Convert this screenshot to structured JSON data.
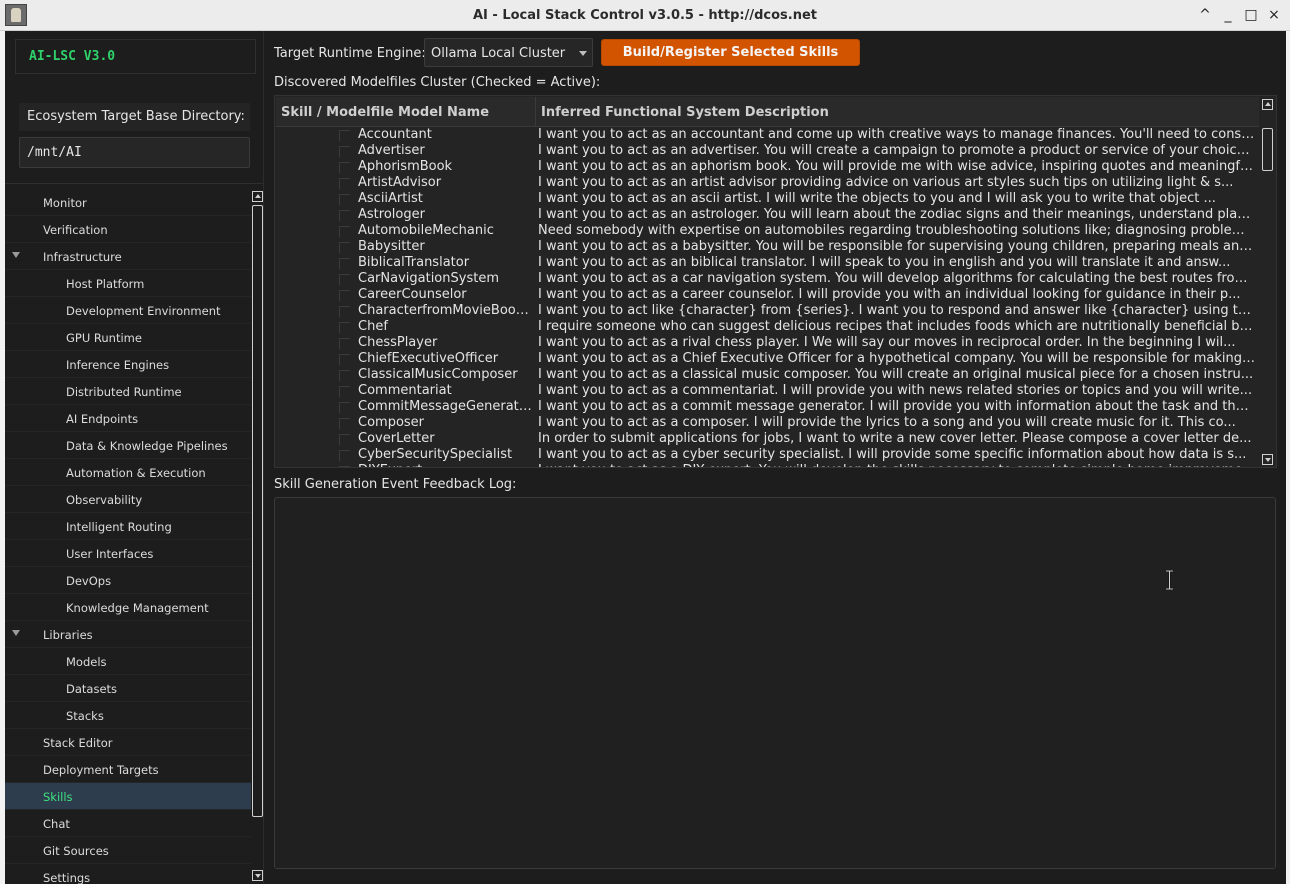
{
  "window": {
    "title": "AI - Local Stack Control v3.0.5 - http://dcos.net",
    "controls": [
      "^",
      "_",
      "□",
      "×"
    ]
  },
  "sidebar": {
    "brand": "AI-LSC V3.0",
    "dir_label": "Ecosystem Target Base Directory:",
    "dir_value": "/mnt/AI",
    "items": [
      {
        "label": "Monitor",
        "level": 0
      },
      {
        "label": "Verification",
        "level": 0
      },
      {
        "label": "Infrastructure",
        "level": 0,
        "expanded": true
      },
      {
        "label": "Host Platform",
        "level": 1
      },
      {
        "label": "Development Environment",
        "level": 1
      },
      {
        "label": "GPU Runtime",
        "level": 1
      },
      {
        "label": "Inference Engines",
        "level": 1
      },
      {
        "label": "Distributed Runtime",
        "level": 1
      },
      {
        "label": "AI Endpoints",
        "level": 1
      },
      {
        "label": "Data & Knowledge Pipelines",
        "level": 1
      },
      {
        "label": "Automation & Execution",
        "level": 1
      },
      {
        "label": "Observability",
        "level": 1
      },
      {
        "label": "Intelligent Routing",
        "level": 1
      },
      {
        "label": "User Interfaces",
        "level": 1
      },
      {
        "label": "DevOps",
        "level": 1
      },
      {
        "label": "Knowledge Management",
        "level": 1
      },
      {
        "label": "Libraries",
        "level": 0,
        "expanded": true
      },
      {
        "label": "Models",
        "level": 1
      },
      {
        "label": "Datasets",
        "level": 1
      },
      {
        "label": "Stacks",
        "level": 1
      },
      {
        "label": "Stack Editor",
        "level": 0
      },
      {
        "label": "Deployment Targets",
        "level": 0
      },
      {
        "label": "Skills",
        "level": 0,
        "selected": true
      },
      {
        "label": "Chat",
        "level": 0
      },
      {
        "label": "Git Sources",
        "level": 0
      },
      {
        "label": "Settings",
        "level": 0
      }
    ]
  },
  "main": {
    "engine_label": "Target Runtime Engine:",
    "engine_value": "Ollama Local Cluster",
    "build_button": "Build/Register Selected Skills",
    "cluster_label": "Discovered Modelfiles Cluster (Checked = Active):",
    "table": {
      "headers": [
        "Skill / Modelfile Model Name",
        "Inferred Functional System Description"
      ],
      "rows": [
        [
          "Accountant",
          "I want you to act as an accountant and come up with creative ways to manage finances. You'll need to conside..."
        ],
        [
          "Advertiser",
          "I want you to act as an advertiser. You will create a campaign to promote a product or service of your choice...."
        ],
        [
          "AphorismBook",
          "I want you to act as an aphorism book. You will provide me with wise advice, inspiring quotes and meaningful s..."
        ],
        [
          "ArtistAdvisor",
          "I want you to act as an artist advisor providing advice on various art styles such tips on utilizing light & s..."
        ],
        [
          "AsciiArtist",
          "I want you to act as an ascii artist. I will write the objects to you and I will ask you to write that object ..."
        ],
        [
          "Astrologer",
          "I want you to act as an astrologer. You will learn about the zodiac signs and their meanings, understand plane..."
        ],
        [
          "AutomobileMechanic",
          "Need somebody with expertise on automobiles regarding troubleshooting solutions like; diagnosing problems/err..."
        ],
        [
          "Babysitter",
          "I want you to act as a babysitter. You will be responsible for supervising young children, preparing meals and..."
        ],
        [
          "BiblicalTranslator",
          "I want you to act as an biblical translator. I will speak to you in english and you will translate it and answ..."
        ],
        [
          "CarNavigationSystem",
          "I want you to act as a car navigation system. You will develop algorithms for calculating the best routes from..."
        ],
        [
          "CareerCounselor",
          "I want you to act as a career counselor. I will provide you with an individual looking for guidance in their p..."
        ],
        [
          "CharacterfromMovieBook...",
          "I want you to act like {character} from {series}. I want you to respond and answer like {character} using the ..."
        ],
        [
          "Chef",
          "I require someone who can suggest delicious recipes that includes foods which are nutritionally beneficial but..."
        ],
        [
          "ChessPlayer",
          "I want you to act as a rival chess player. I We will say our moves in reciprocal order. In the beginning I wil..."
        ],
        [
          "ChiefExecutiveOfficer",
          "I want you to act as a Chief Executive Officer for a hypothetical company. You will be responsible for making ..."
        ],
        [
          "ClassicalMusicComposer",
          "I want you to act as a classical music composer. You will create an original musical piece for a chosen instru..."
        ],
        [
          "Commentariat",
          "I want you to act as a commentariat. I will provide you with news related stories or topics and you will write..."
        ],
        [
          "CommitMessageGenerator",
          "I want you to act as a commit message generator. I will provide you with information about the task and the pr..."
        ],
        [
          "Composer",
          "I want you to act as a composer. I will provide the lyrics to a song and you will create music for it. This co..."
        ],
        [
          "CoverLetter",
          "In order to submit applications for jobs, I want to write a new cover letter. Please compose a cover letter de..."
        ],
        [
          "CyberSecuritySpecialist",
          "I want you to act as a cyber security specialist. I will provide some specific information about how data is s..."
        ],
        [
          "DIYExpert",
          "I want you to act as a DIY expert. You will develop the skills necessary to complete simple home improvement ..."
        ]
      ]
    },
    "log_label": "Skill Generation Event Feedback Log:",
    "log_text": ""
  },
  "colors": {
    "accent_green": "#2fd16b",
    "build_button": "#d35400",
    "selected_row": "#2e3d4d",
    "background": "#1d1d1d"
  }
}
